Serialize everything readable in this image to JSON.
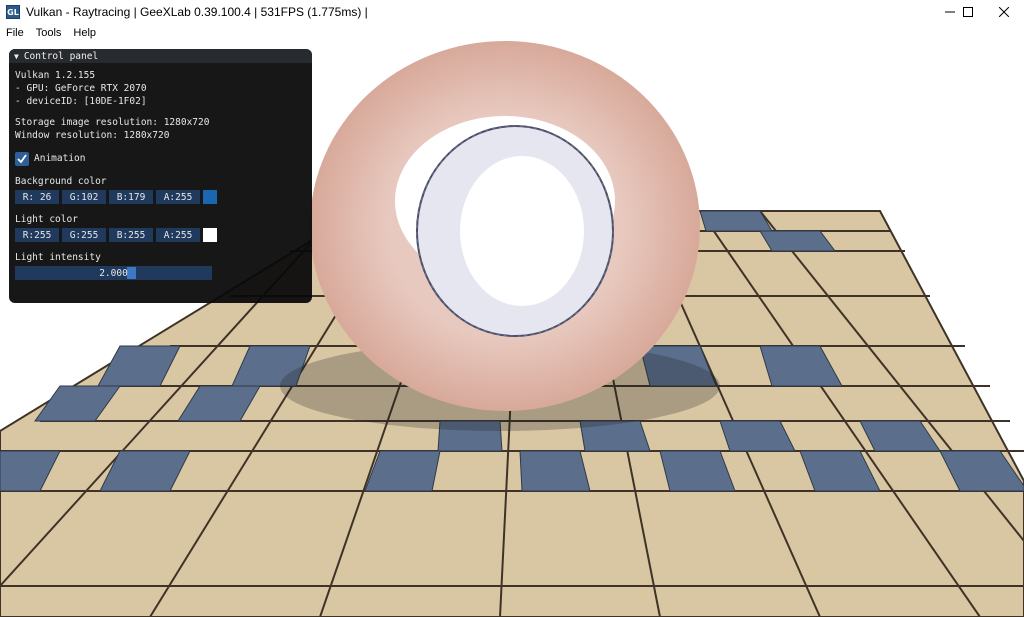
{
  "window": {
    "title": "Vulkan - Raytracing | GeeXLab 0.39.100.4 | 531FPS (1.775ms) |",
    "icon": "GL"
  },
  "menu": [
    "File",
    "Tools",
    "Help"
  ],
  "panel": {
    "header": "Control panel",
    "info": {
      "vulkan": "Vulkan 1.2.155",
      "gpu": "- GPU: GeForce RTX 2070",
      "device": "- deviceID: [10DE-1F02]",
      "storage_res": "Storage image resolution: 1280x720",
      "window_res": "Window resolution: 1280x720"
    },
    "animation": {
      "label": "Animation",
      "checked": true
    },
    "background_color": {
      "label": "Background color",
      "r": "R: 26",
      "g": "G:102",
      "b": "B:179",
      "a": "A:255",
      "swatch": "#1a66b3"
    },
    "light_color": {
      "label": "Light color",
      "r": "R:255",
      "g": "G:255",
      "b": "B:255",
      "a": "A:255",
      "swatch": "#ffffff"
    },
    "light_intensity": {
      "label": "Light intensity",
      "value": "2.000"
    }
  },
  "colors": {
    "panel_bg": "#08080a",
    "field_bg": "#1f3a5c",
    "accent": "#3d78c4"
  }
}
